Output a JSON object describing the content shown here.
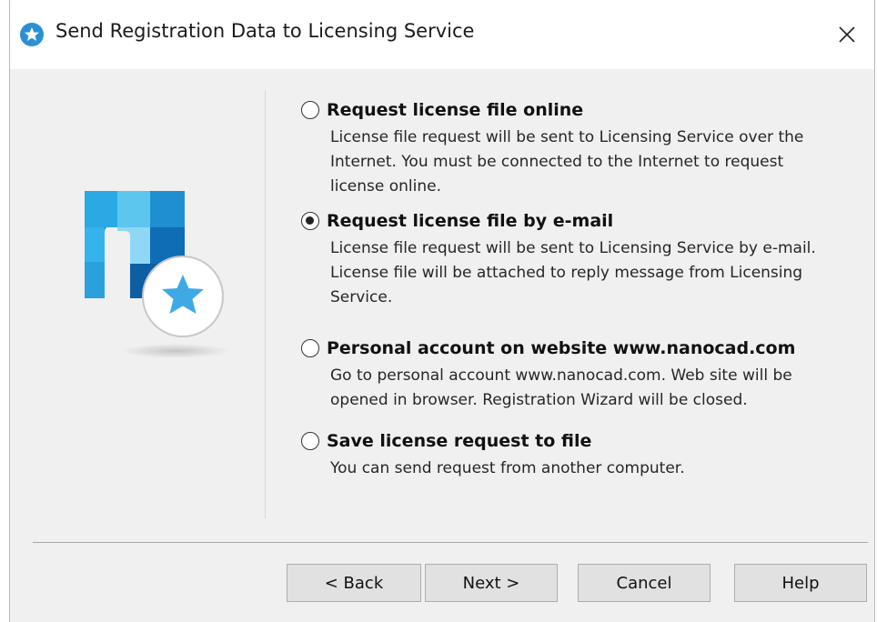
{
  "window": {
    "title": "Send Registration Data to Licensing Service",
    "icon": "nanocad-star-icon",
    "close_icon": "close-icon"
  },
  "logo": {
    "icon": "nanocad-logo-icon"
  },
  "options": [
    {
      "label": "Request license file online",
      "description": "License file request will be sent to Licensing Service over the Internet. You must be connected to the Internet to request license online.",
      "selected": false
    },
    {
      "label": "Request license file by e-mail",
      "description": "License file request will be sent to Licensing Service by e-mail. License file will be attached to reply message from Licensing Service.",
      "selected": true
    },
    {
      "label": "Personal account on website www.nanocad.com",
      "description": "Go to personal account www.nanocad.com. Web site will be opened in browser. Registration Wizard will be closed.",
      "selected": false
    },
    {
      "label": "Save license request to file",
      "description": "You can send request from another computer.",
      "selected": false
    }
  ],
  "buttons": {
    "back": "< Back",
    "next": "Next >",
    "cancel": "Cancel",
    "help": "Help"
  }
}
